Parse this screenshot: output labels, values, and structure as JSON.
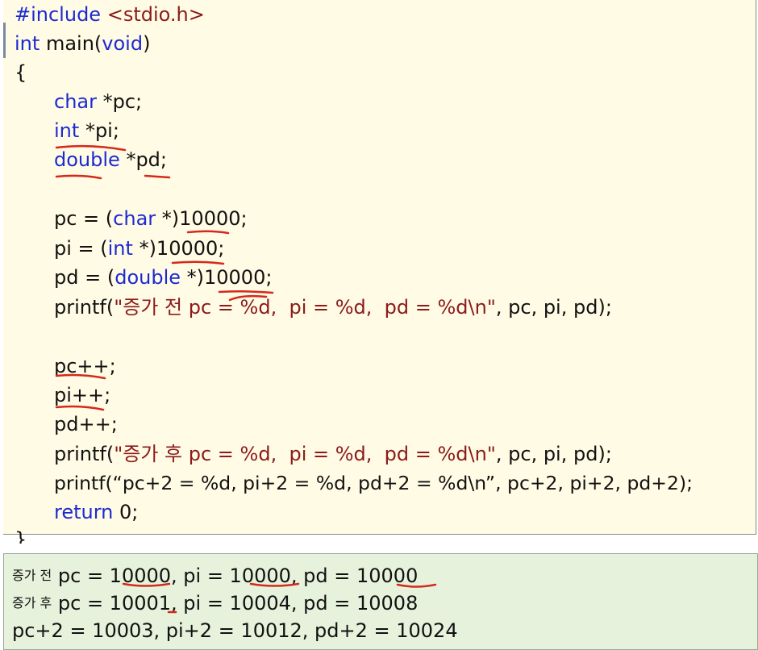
{
  "code": {
    "include_directive": "#include",
    "include_header": "<stdio.h>",
    "line_main": [
      "int",
      "main",
      "(",
      "void",
      ")"
    ],
    "open_brace": "{",
    "decl_char": [
      "char",
      "*pc;"
    ],
    "decl_int": [
      "int",
      "*pi;"
    ],
    "decl_double": [
      "double",
      "*pd;"
    ],
    "assign_pc": [
      "pc = (",
      "char",
      " *)10000;"
    ],
    "assign_pi": [
      "pi = (",
      "int",
      " *)10000;"
    ],
    "assign_pd": [
      "pd = (",
      "double",
      " *)10000;"
    ],
    "printf_before": [
      "printf(",
      "\"증가 전 pc = %d,  pi = %d,  pd = %d\\n\"",
      ", pc, pi, pd);"
    ],
    "inc_pc": "pc++;",
    "inc_pi": "pi++;",
    "inc_pd": "pd++;",
    "printf_after": [
      "printf(",
      "\"증가 후 pc = %d,  pi = %d,  pd = %d\\n\"",
      ", pc, pi, pd);"
    ],
    "printf_plus2": "printf(“pc+2 = %d, pi+2 = %d, pd+2 = %d\\n”, pc+2, pi+2, pd+2);",
    "return_stmt": [
      "return",
      " 0;"
    ],
    "close_brace": "}"
  },
  "output": {
    "line1_prefix": "증가 전",
    "line1_text": " pc = 10000, pi = 10000, pd = 10000",
    "line2_prefix": "증가 후",
    "line2_text": " pc = 10001, pi = 10004, pd = 10008",
    "line3_text": "pc+2 = 10003, pi+2 = 10012, pd+2 = 10024"
  },
  "colors": {
    "code_background": "#fffbe5",
    "output_background": "#e6f2dc",
    "keyword": "#1c2bd0",
    "string": "#8b1a1a",
    "annotation_ink": "#d42a1c"
  }
}
